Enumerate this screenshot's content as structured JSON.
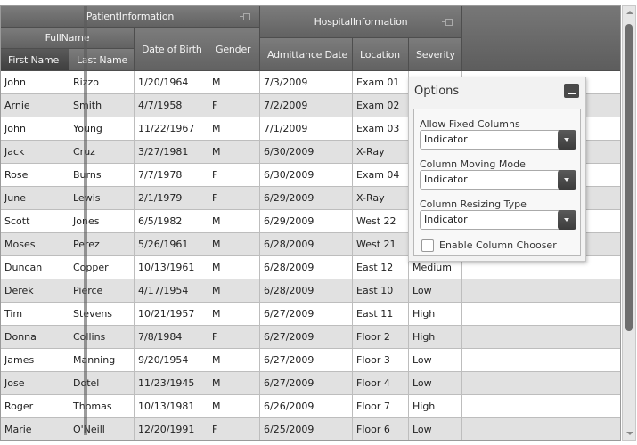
{
  "headers": {
    "groups": {
      "patient_information": "PatientInformation",
      "hospital_information": "HospitalInformation",
      "full_name": "FullName"
    },
    "columns": {
      "first_name": "First Name",
      "last_name": "Last Name",
      "date_of_birth": "Date of Birth",
      "gender": "Gender",
      "admittance_date": "Admittance Date",
      "location": "Location",
      "severity": "Severity"
    }
  },
  "rows": [
    {
      "first": "John",
      "last": "Rizzo",
      "dob": "1/20/1964",
      "gender": "M",
      "admit": "7/3/2009",
      "location": "Exam 01",
      "severity": ""
    },
    {
      "first": "Arnie",
      "last": "Smith",
      "dob": "4/7/1958",
      "gender": "F",
      "admit": "7/2/2009",
      "location": "Exam 02",
      "severity": ""
    },
    {
      "first": "John",
      "last": "Young",
      "dob": "11/22/1967",
      "gender": "M",
      "admit": "7/1/2009",
      "location": "Exam 03",
      "severity": ""
    },
    {
      "first": "Jack",
      "last": "Cruz",
      "dob": "3/27/1981",
      "gender": "M",
      "admit": "6/30/2009",
      "location": "X-Ray",
      "severity": ""
    },
    {
      "first": "Rose",
      "last": "Burns",
      "dob": "7/7/1978",
      "gender": "F",
      "admit": "6/30/2009",
      "location": "Exam 04",
      "severity": ""
    },
    {
      "first": "June",
      "last": "Lewis",
      "dob": "2/1/1979",
      "gender": "F",
      "admit": "6/29/2009",
      "location": "X-Ray",
      "severity": ""
    },
    {
      "first": "Scott",
      "last": "Jones",
      "dob": "6/5/1982",
      "gender": "M",
      "admit": "6/29/2009",
      "location": "West 22",
      "severity": ""
    },
    {
      "first": "Moses",
      "last": "Perez",
      "dob": "5/26/1961",
      "gender": "M",
      "admit": "6/28/2009",
      "location": "West 21",
      "severity": ""
    },
    {
      "first": "Duncan",
      "last": "Copper",
      "dob": "10/13/1961",
      "gender": "M",
      "admit": "6/28/2009",
      "location": "East 12",
      "severity": "Medium"
    },
    {
      "first": "Derek",
      "last": "Pierce",
      "dob": "4/17/1954",
      "gender": "M",
      "admit": "6/28/2009",
      "location": "East 10",
      "severity": "Low"
    },
    {
      "first": "Tim",
      "last": "Stevens",
      "dob": "10/21/1957",
      "gender": "M",
      "admit": "6/27/2009",
      "location": "East 11",
      "severity": "High"
    },
    {
      "first": "Donna",
      "last": "Collins",
      "dob": "7/8/1984",
      "gender": "F",
      "admit": "6/27/2009",
      "location": "Floor 2",
      "severity": "High"
    },
    {
      "first": "James",
      "last": "Manning",
      "dob": "9/20/1954",
      "gender": "M",
      "admit": "6/27/2009",
      "location": "Floor 3",
      "severity": "Low"
    },
    {
      "first": "Jose",
      "last": "Dotel",
      "dob": "11/23/1945",
      "gender": "M",
      "admit": "6/27/2009",
      "location": "Floor 4",
      "severity": "Low"
    },
    {
      "first": "Roger",
      "last": "Thomas",
      "dob": "10/13/1981",
      "gender": "M",
      "admit": "6/26/2009",
      "location": "Floor 7",
      "severity": "High"
    },
    {
      "first": "Marie",
      "last": "O'Neill",
      "dob": "12/20/1991",
      "gender": "F",
      "admit": "6/25/2009",
      "location": "Floor 6",
      "severity": "Low"
    }
  ],
  "options": {
    "title": "Options",
    "allow_fixed_columns": {
      "label": "Allow Fixed Columns",
      "value": "Indicator"
    },
    "column_moving_mode": {
      "label": "Column Moving Mode",
      "value": "Indicator"
    },
    "column_resizing_type": {
      "label": "Column Resizing Type",
      "value": "Indicator"
    },
    "enable_column_chooser": {
      "label": "Enable Column Chooser",
      "checked": false
    }
  }
}
